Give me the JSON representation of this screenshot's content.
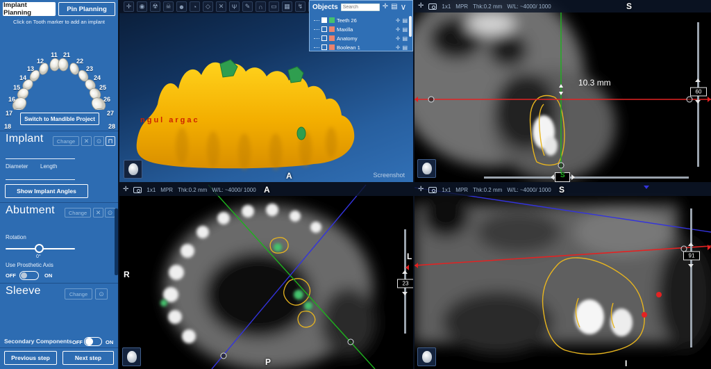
{
  "sidebar": {
    "tabs": [
      {
        "label": "Implant Planning"
      },
      {
        "label": "Pin Planning"
      }
    ],
    "instruction": "Click on Tooth marker to add an implant",
    "tooth_numbers_left": [
      "11",
      "12",
      "13",
      "14",
      "15",
      "16",
      "17",
      "18"
    ],
    "tooth_numbers_right": [
      "21",
      "22",
      "23",
      "24",
      "25",
      "26",
      "27",
      "28"
    ],
    "switch_button": "Switch to Mandible Project",
    "implant_title": "Implant",
    "implant_change": "Change",
    "diameter_label": "Diameter",
    "length_label": "Length",
    "angles_button": "Show Implant Angles",
    "abutment_title": "Abutment",
    "abutment_change": "Change",
    "rotation_label": "Rotation",
    "rotation_value": "0°",
    "prosthetic_label": "Use Prosthetic Axis",
    "off": "OFF",
    "on": "ON",
    "sleeve_title": "Sleeve",
    "sleeve_change": "Change",
    "secondary_label": "Secondary Components",
    "prev_button": "Previous step",
    "next_button": "Next step"
  },
  "toolbar3d": {
    "icons": [
      {
        "name": "pan",
        "glyph": "✛"
      },
      {
        "name": "camera",
        "glyph": "◉"
      },
      {
        "name": "volume-render",
        "glyph": "☢"
      },
      {
        "name": "skull",
        "glyph": "☠"
      },
      {
        "name": "head",
        "glyph": "☻"
      },
      {
        "name": "orientation",
        "glyph": "◔"
      },
      {
        "name": "tooth",
        "glyph": "◇"
      },
      {
        "name": "delete",
        "glyph": "✕"
      },
      {
        "name": "nerve",
        "glyph": "Ψ"
      },
      {
        "name": "pen",
        "glyph": "✎"
      },
      {
        "name": "bridge",
        "glyph": "∩"
      },
      {
        "name": "panorama",
        "glyph": "▭"
      },
      {
        "name": "image",
        "glyph": "▦"
      },
      {
        "name": "lightning",
        "glyph": "↯"
      },
      {
        "name": "draw",
        "glyph": "✏"
      },
      {
        "name": "curve",
        "glyph": "◡"
      },
      {
        "name": "grid",
        "glyph": "▩"
      }
    ]
  },
  "objects_panel": {
    "title": "Objects",
    "search_placeholder": "Search",
    "items": [
      {
        "label": "Teeth 26",
        "checked": true,
        "color": "#44c26d"
      },
      {
        "label": "Maxilla",
        "checked": false,
        "color": "#e9836e"
      },
      {
        "label": "Anatomy",
        "checked": false,
        "color": "#e9836e"
      },
      {
        "label": "Boolean 1",
        "checked": false,
        "color": "#e9836e"
      }
    ]
  },
  "view3d": {
    "model_text": "ngul argac",
    "screenshot_label": "Screenshot",
    "orientation_bottom": "A"
  },
  "coronal": {
    "zoom": "1x1",
    "mode": "MPR",
    "thickness": "Thk:0.2 mm",
    "wl": "W/L: ~4000/ 1000",
    "measurement": "10.3 mm",
    "slice": "60",
    "orientation_top": "S",
    "orientation_bottom": "S"
  },
  "axial": {
    "zoom": "1x1",
    "mode": "MPR",
    "thickness": "Thk:0.2 mm",
    "wl": "W/L: ~4000/ 1000",
    "slice": "23",
    "orientation_top": "A",
    "orientation_bottom": "P",
    "orientation_left": "R",
    "orientation_right": "L"
  },
  "sagittal": {
    "zoom": "1x1",
    "mode": "MPR",
    "thickness": "Thk:0.2 mm",
    "wl": "W/L: ~4000/ 1000",
    "slice": "91",
    "orientation_top": "S",
    "orientation_bottom": "I"
  },
  "colors": {
    "sidebar_blue": "#2d6cb2",
    "crosshair_green": "#1db21d",
    "crosshair_red": "#e32222",
    "crosshair_blue": "#3333dd",
    "contour_yellow": "#e8b51f",
    "model_yellow": "#f5b800"
  }
}
